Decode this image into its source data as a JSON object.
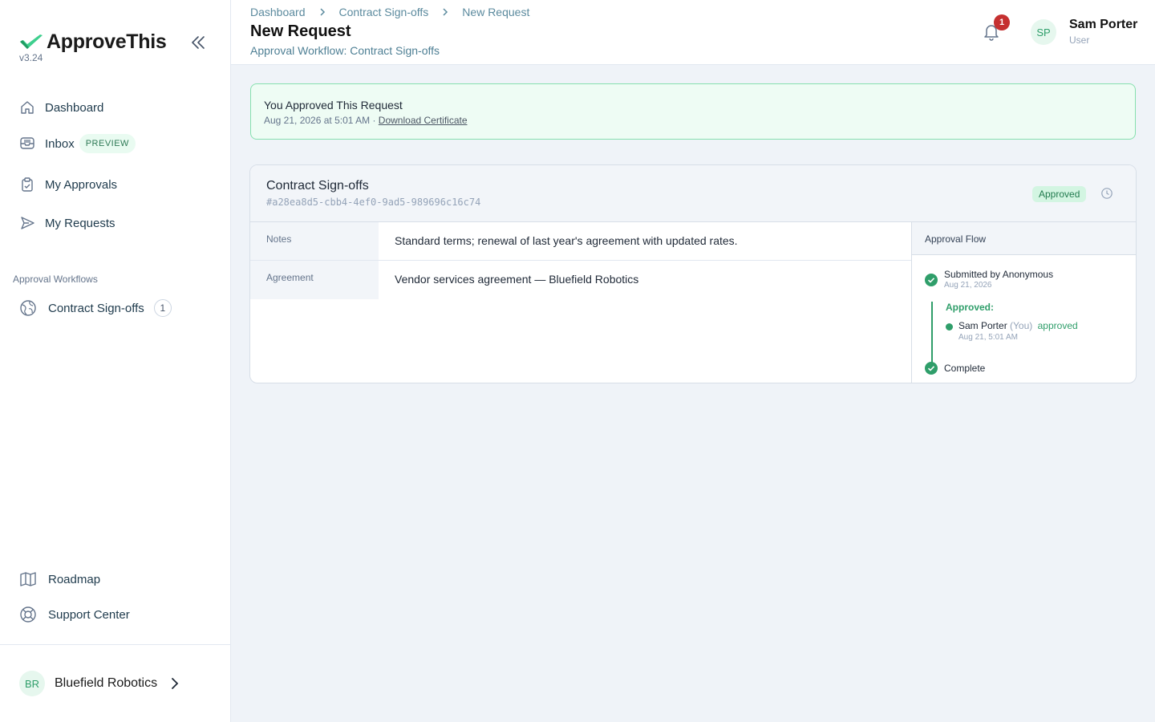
{
  "app": {
    "name": "ApproveThis",
    "version": "v3.24"
  },
  "sidebar": {
    "nav": [
      {
        "label": "Dashboard",
        "icon": "home-icon"
      },
      {
        "label": "Inbox",
        "icon": "inbox-icon",
        "badge": "PREVIEW"
      },
      {
        "label": "My Approvals",
        "icon": "clipboard-check-icon"
      },
      {
        "label": "My Requests",
        "icon": "send-icon"
      }
    ],
    "section_title": "Approval Workflows",
    "workflows": [
      {
        "label": "Contract Sign-offs",
        "count": "1",
        "icon": "globe-icon"
      }
    ],
    "bottom": [
      {
        "label": "Roadmap",
        "icon": "map-icon"
      },
      {
        "label": "Support Center",
        "icon": "lifebuoy-icon"
      }
    ],
    "org": {
      "initials": "BR",
      "name": "Bluefield Robotics"
    }
  },
  "header": {
    "breadcrumb": [
      "Dashboard",
      "Contract Sign-offs",
      "New Request"
    ],
    "title": "New Request",
    "subtitle": "Approval Workflow: Contract Sign-offs",
    "notifications": "1",
    "user": {
      "initials": "SP",
      "name": "Sam Porter",
      "role": "User"
    }
  },
  "banner": {
    "title": "You Approved This Request",
    "date": "Aug 21, 2026 at 5:01 AM",
    "separator": "·",
    "link": "Download Certificate"
  },
  "request": {
    "title": "Contract Sign-offs",
    "id": "#a28ea8d5-cbb4-4ef0-9ad5-989696c16c74",
    "status": "Approved",
    "fields": [
      {
        "label": "Notes",
        "value": "Standard terms; renewal of last year's agreement with updated rates."
      },
      {
        "label": "Agreement",
        "value": "Vendor services agreement — Bluefield Robotics"
      }
    ]
  },
  "flow": {
    "title": "Approval Flow",
    "submitted": "Submitted by Anonymous",
    "submitted_date": "Aug 21, 2026",
    "approved_label": "Approved:",
    "approver": "Sam Porter",
    "approver_tag": "(You)",
    "approver_action": "approved",
    "approver_date": "Aug 21, 5:01 AM",
    "complete": "Complete"
  },
  "colors": {
    "accent": "#2f9e6a",
    "badge_red": "#c53030",
    "banner_bg": "#eefcf4"
  }
}
